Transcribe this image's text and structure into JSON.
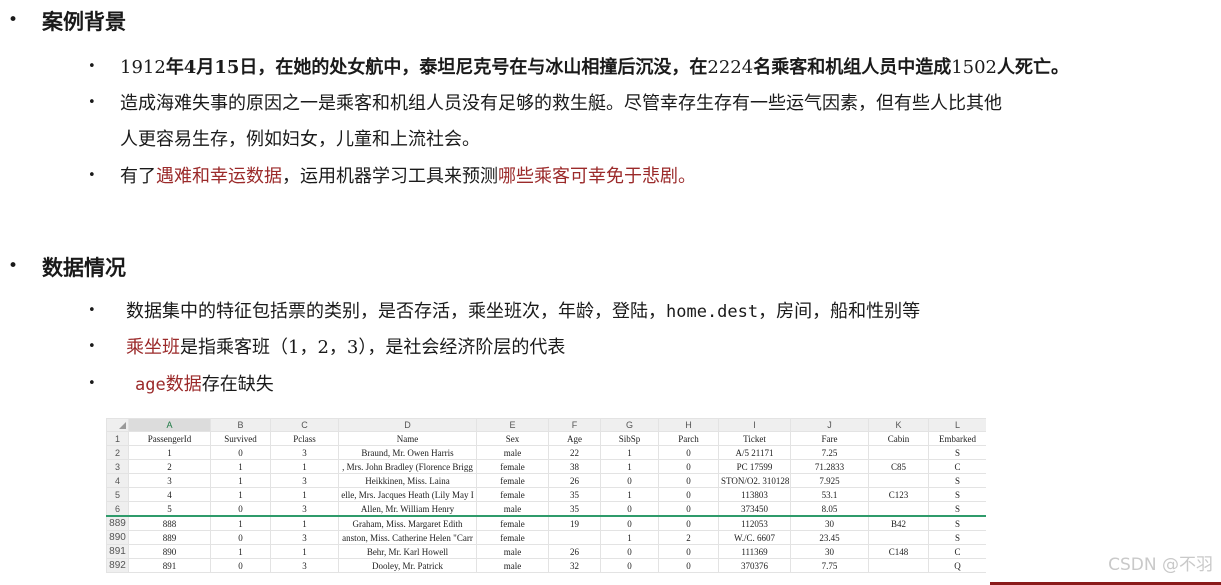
{
  "section1": {
    "title": "案例背景",
    "items": [
      {
        "runs": [
          {
            "t": "1912",
            "c": ""
          },
          {
            "t": "年4月15日，在她的处女航中，泰坦尼克号在与冰山相撞后沉没，在",
            "c": "bold"
          },
          {
            "t": "2224",
            "c": ""
          },
          {
            "t": "名乘客和机组人员中造成",
            "c": "bold"
          },
          {
            "t": "1502",
            "c": ""
          },
          {
            "t": "人死亡。",
            "c": "bold"
          }
        ]
      },
      {
        "runs": [
          {
            "t": "造成海难失事的原因之一是乘客和机组人员没有足够的救生艇。尽管幸存生存有一些运气因素，但有些人比其他",
            "c": ""
          }
        ]
      },
      {
        "runs": [
          {
            "t": "人更容易生存，例如妇女，儿童和上流社会。",
            "c": ""
          }
        ]
      },
      {
        "runs": [
          {
            "t": "有了",
            "c": ""
          },
          {
            "t": "遇难和幸运数据",
            "c": "red"
          },
          {
            "t": "，运用机器学习工具来预测",
            "c": ""
          },
          {
            "t": "哪些乘客可幸免于悲剧。",
            "c": "red"
          }
        ]
      }
    ]
  },
  "section2": {
    "title": "数据情况",
    "items": [
      {
        "runs": [
          {
            "t": "数据集中的特征包括票的类别，是否存活，乘坐班次，年龄，登陆，",
            "c": ""
          },
          {
            "t": "home.dest",
            "c": "mono"
          },
          {
            "t": "，房间，船和性别等",
            "c": ""
          }
        ]
      },
      {
        "runs": [
          {
            "t": "乘坐班",
            "c": "red"
          },
          {
            "t": "是指乘客班（1，2，3），是社会经济阶层的代表",
            "c": ""
          }
        ]
      },
      {
        "runs": [
          {
            "t": "age",
            "c": "mono red"
          },
          {
            "t": "数据",
            "c": "red"
          },
          {
            "t": "存在缺失",
            "c": ""
          }
        ]
      }
    ]
  },
  "sheet": {
    "columns": [
      "A",
      "B",
      "C",
      "D",
      "E",
      "F",
      "G",
      "H",
      "I",
      "J",
      "K",
      "L"
    ],
    "rows": [
      {
        "rn": "1",
        "cells": [
          "PassengerId",
          "Survived",
          "Pclass",
          "Name",
          "Sex",
          "Age",
          "SibSp",
          "Parch",
          "Ticket",
          "Fare",
          "Cabin",
          "Embarked"
        ]
      },
      {
        "rn": "2",
        "cells": [
          "1",
          "0",
          "3",
          "Braund, Mr. Owen Harris",
          "male",
          "22",
          "1",
          "0",
          "A/5 21171",
          "7.25",
          "",
          "S"
        ]
      },
      {
        "rn": "3",
        "cells": [
          "2",
          "1",
          "1",
          ", Mrs. John Bradley (Florence Brigg",
          "female",
          "38",
          "1",
          "0",
          "PC 17599",
          "71.2833",
          "C85",
          "C"
        ]
      },
      {
        "rn": "4",
        "cells": [
          "3",
          "1",
          "3",
          "Heikkinen, Miss. Laina",
          "female",
          "26",
          "0",
          "0",
          "STON/O2. 310128",
          "7.925",
          "",
          "S"
        ]
      },
      {
        "rn": "5",
        "cells": [
          "4",
          "1",
          "1",
          "elle, Mrs. Jacques Heath (Lily May I",
          "female",
          "35",
          "1",
          "0",
          "113803",
          "53.1",
          "C123",
          "S"
        ]
      },
      {
        "rn": "6",
        "cells": [
          "5",
          "0",
          "3",
          "Allen, Mr. William Henry",
          "male",
          "35",
          "0",
          "0",
          "373450",
          "8.05",
          "",
          "S"
        ]
      },
      {
        "rn": "889",
        "cells": [
          "888",
          "1",
          "1",
          "Graham, Miss. Margaret Edith",
          "female",
          "19",
          "0",
          "0",
          "112053",
          "30",
          "B42",
          "S"
        ]
      },
      {
        "rn": "890",
        "cells": [
          "889",
          "0",
          "3",
          "anston, Miss. Catherine Helen \"Carr",
          "female",
          "",
          "1",
          "2",
          "W./C. 6607",
          "23.45",
          "",
          "S"
        ]
      },
      {
        "rn": "891",
        "cells": [
          "890",
          "1",
          "1",
          "Behr, Mr. Karl Howell",
          "male",
          "26",
          "0",
          "0",
          "111369",
          "30",
          "C148",
          "C"
        ]
      },
      {
        "rn": "892",
        "cells": [
          "891",
          "0",
          "3",
          "Dooley, Mr. Patrick",
          "male",
          "32",
          "0",
          "0",
          "370376",
          "7.75",
          "",
          "Q"
        ]
      }
    ]
  },
  "watermark": "CSDN @不羽"
}
